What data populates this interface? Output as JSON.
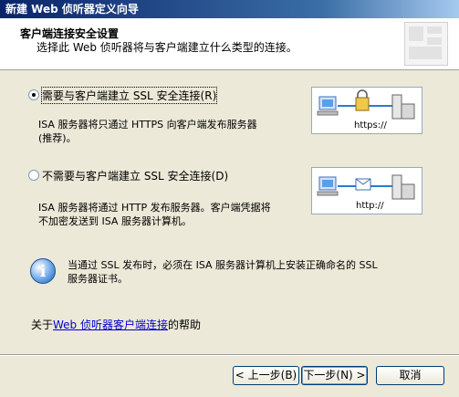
{
  "window": {
    "title": "新建 Web 侦听器定义向导"
  },
  "header": {
    "title": "客户端连接安全设置",
    "subtitle": "选择此 Web 侦听器将与客户端建立什么类型的连接。"
  },
  "options": [
    {
      "label": "需要与客户端建立 SSL 安全连接(R)",
      "selected": true,
      "description": [
        "ISA 服务器将只通过 HTTPS 向客户端发布服务器",
        "(推荐)。"
      ],
      "diagram_text": "https://"
    },
    {
      "label": "不需要与客户端建立 SSL 安全连接(D)",
      "selected": false,
      "description": [
        "ISA 服务器将通过 HTTP 发布服务器。客户端凭据将",
        "不加密发送到 ISA 服务器计算机。"
      ],
      "diagram_text": "http://"
    }
  ],
  "info": {
    "text": [
      "当通过 SSL 发布时，必须在 ISA 服务器计算机上安装正确命名的 SSL",
      "服务器证书。"
    ]
  },
  "help": {
    "prefix": "关于",
    "link": "Web 侦听器客户端连接",
    "suffix": "的帮助"
  },
  "buttons": {
    "back": "< 上一步(B)",
    "next": "下一步(N) >",
    "cancel": "取消"
  },
  "colors": {
    "title_bar": "#0a246a",
    "link": "#0000cc",
    "face": "#ece9d8"
  }
}
